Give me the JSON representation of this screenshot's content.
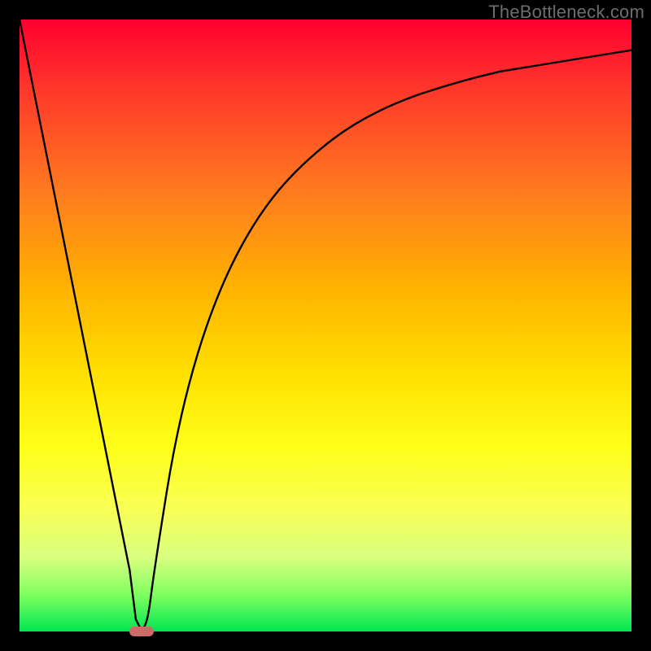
{
  "watermark": "TheBottleneck.com",
  "chart_data": {
    "type": "line",
    "title": "",
    "xlabel": "",
    "ylabel": "",
    "xlim": [
      0,
      100
    ],
    "ylim": [
      0,
      100
    ],
    "grid": false,
    "series": [
      {
        "name": "main-curve",
        "x": [
          0,
          18,
          19,
          20,
          21,
          22,
          26,
          32,
          40,
          50,
          60,
          72,
          85,
          100
        ],
        "values": [
          100,
          10,
          2,
          0,
          2,
          10,
          35,
          55,
          70,
          80,
          86,
          90,
          93,
          95
        ]
      }
    ],
    "marker": {
      "x": 20,
      "y": 0,
      "width_pct": 4,
      "height_pct": 1.5,
      "color": "#cc6b66"
    },
    "background_gradient": {
      "top": "#ff0030",
      "bottom": "#00e650"
    }
  },
  "frame": {
    "border_color": "#000000",
    "border_px": 24
  }
}
